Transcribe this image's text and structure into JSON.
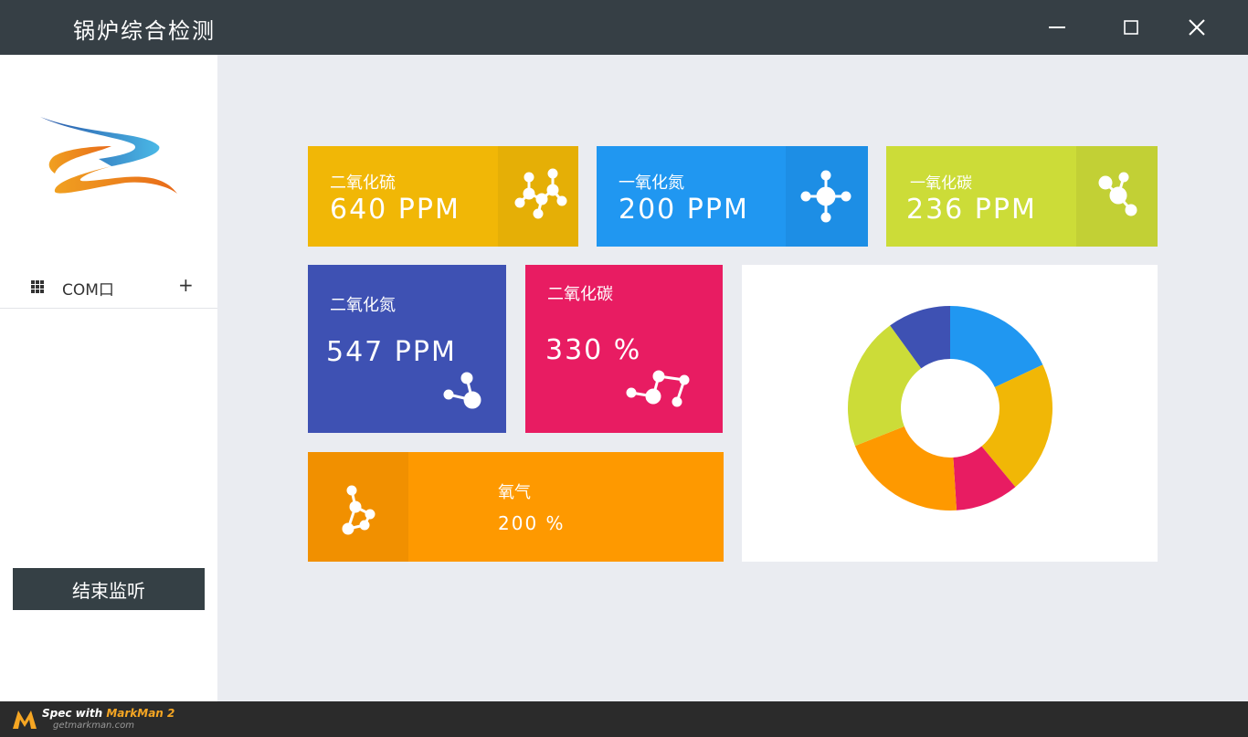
{
  "app": {
    "title": "锅炉综合检测"
  },
  "sidebar": {
    "com_label": "COM口",
    "add_symbol": "+",
    "stop_button": "结束监听"
  },
  "cards": {
    "so2": {
      "name": "二氧化硫",
      "value": "640 PPM",
      "color": "#f1b706",
      "icon_color": "#e5af06"
    },
    "no": {
      "name": "一氧化氮",
      "value": "200 PPM",
      "color": "#2097f1",
      "icon_color": "#1d8ee5"
    },
    "co": {
      "name": "一氧化碳",
      "value": "236 PPM",
      "color": "#ccdc38",
      "icon_color": "#c2d035"
    },
    "no2": {
      "name": "二氧化氮",
      "value": "547 PPM",
      "color": "#3e51b3"
    },
    "co2": {
      "name": "二氧化碳",
      "value": "330 %",
      "color": "#e81c62"
    },
    "o2": {
      "name": "氧气",
      "value": "200 %",
      "color": "#fe9900",
      "icon_color": "#f19000"
    }
  },
  "chart_data": {
    "type": "pie",
    "title": "",
    "labels": [],
    "values": [
      18,
      21,
      10,
      20,
      21,
      10
    ],
    "colors": [
      "#2097f1",
      "#f1b706",
      "#e81c62",
      "#fe9900",
      "#ccdc38",
      "#3e51b3"
    ]
  },
  "footer": {
    "brand_prefix": "Spec with ",
    "brand_name": "MarkMan 2",
    "url": "getmarkman.com"
  },
  "colors": {
    "titlebar": "#363f45",
    "background": "#eaecf1",
    "stop_button": "#354045"
  }
}
